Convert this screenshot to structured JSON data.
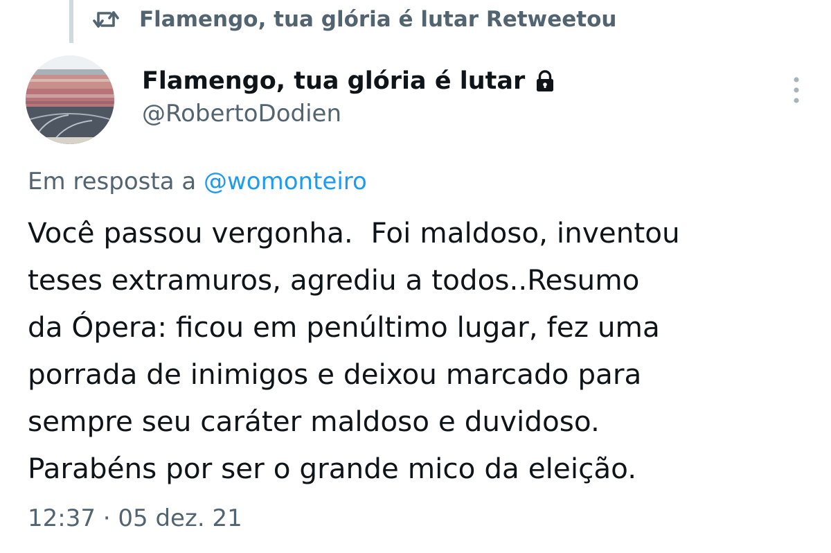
{
  "retweet": {
    "icon": "retweet-icon",
    "text": "Flamengo, tua glória é lutar Retweetou"
  },
  "author": {
    "avatar": "stadium-avatar",
    "name": "Flamengo, tua glória é lutar",
    "protected_icon": "lock-icon",
    "handle": "@RobertoDodien"
  },
  "menu": {
    "icon": "more-vertical-icon"
  },
  "reply": {
    "prefix": "Em resposta a ",
    "mention": "@womonteiro"
  },
  "tweet": {
    "lines": [
      "Você passou vergonha.  Foi maldoso, inventou",
      "teses extramuros, agrediu a todos..Resumo",
      "da Ópera: ficou em penúltimo lugar, fez uma",
      "porrada de inimigos e deixou marcado para",
      "sempre seu caráter maldoso e duvidoso.",
      "Parabéns por ser o grande mico da eleição."
    ]
  },
  "meta": {
    "timestamp": "12:37 · 05 dez. 21"
  },
  "colors": {
    "text_primary": "#0f1419",
    "text_secondary": "#536471",
    "link": "#1d9bf0",
    "thread_line": "#cfd9de"
  }
}
